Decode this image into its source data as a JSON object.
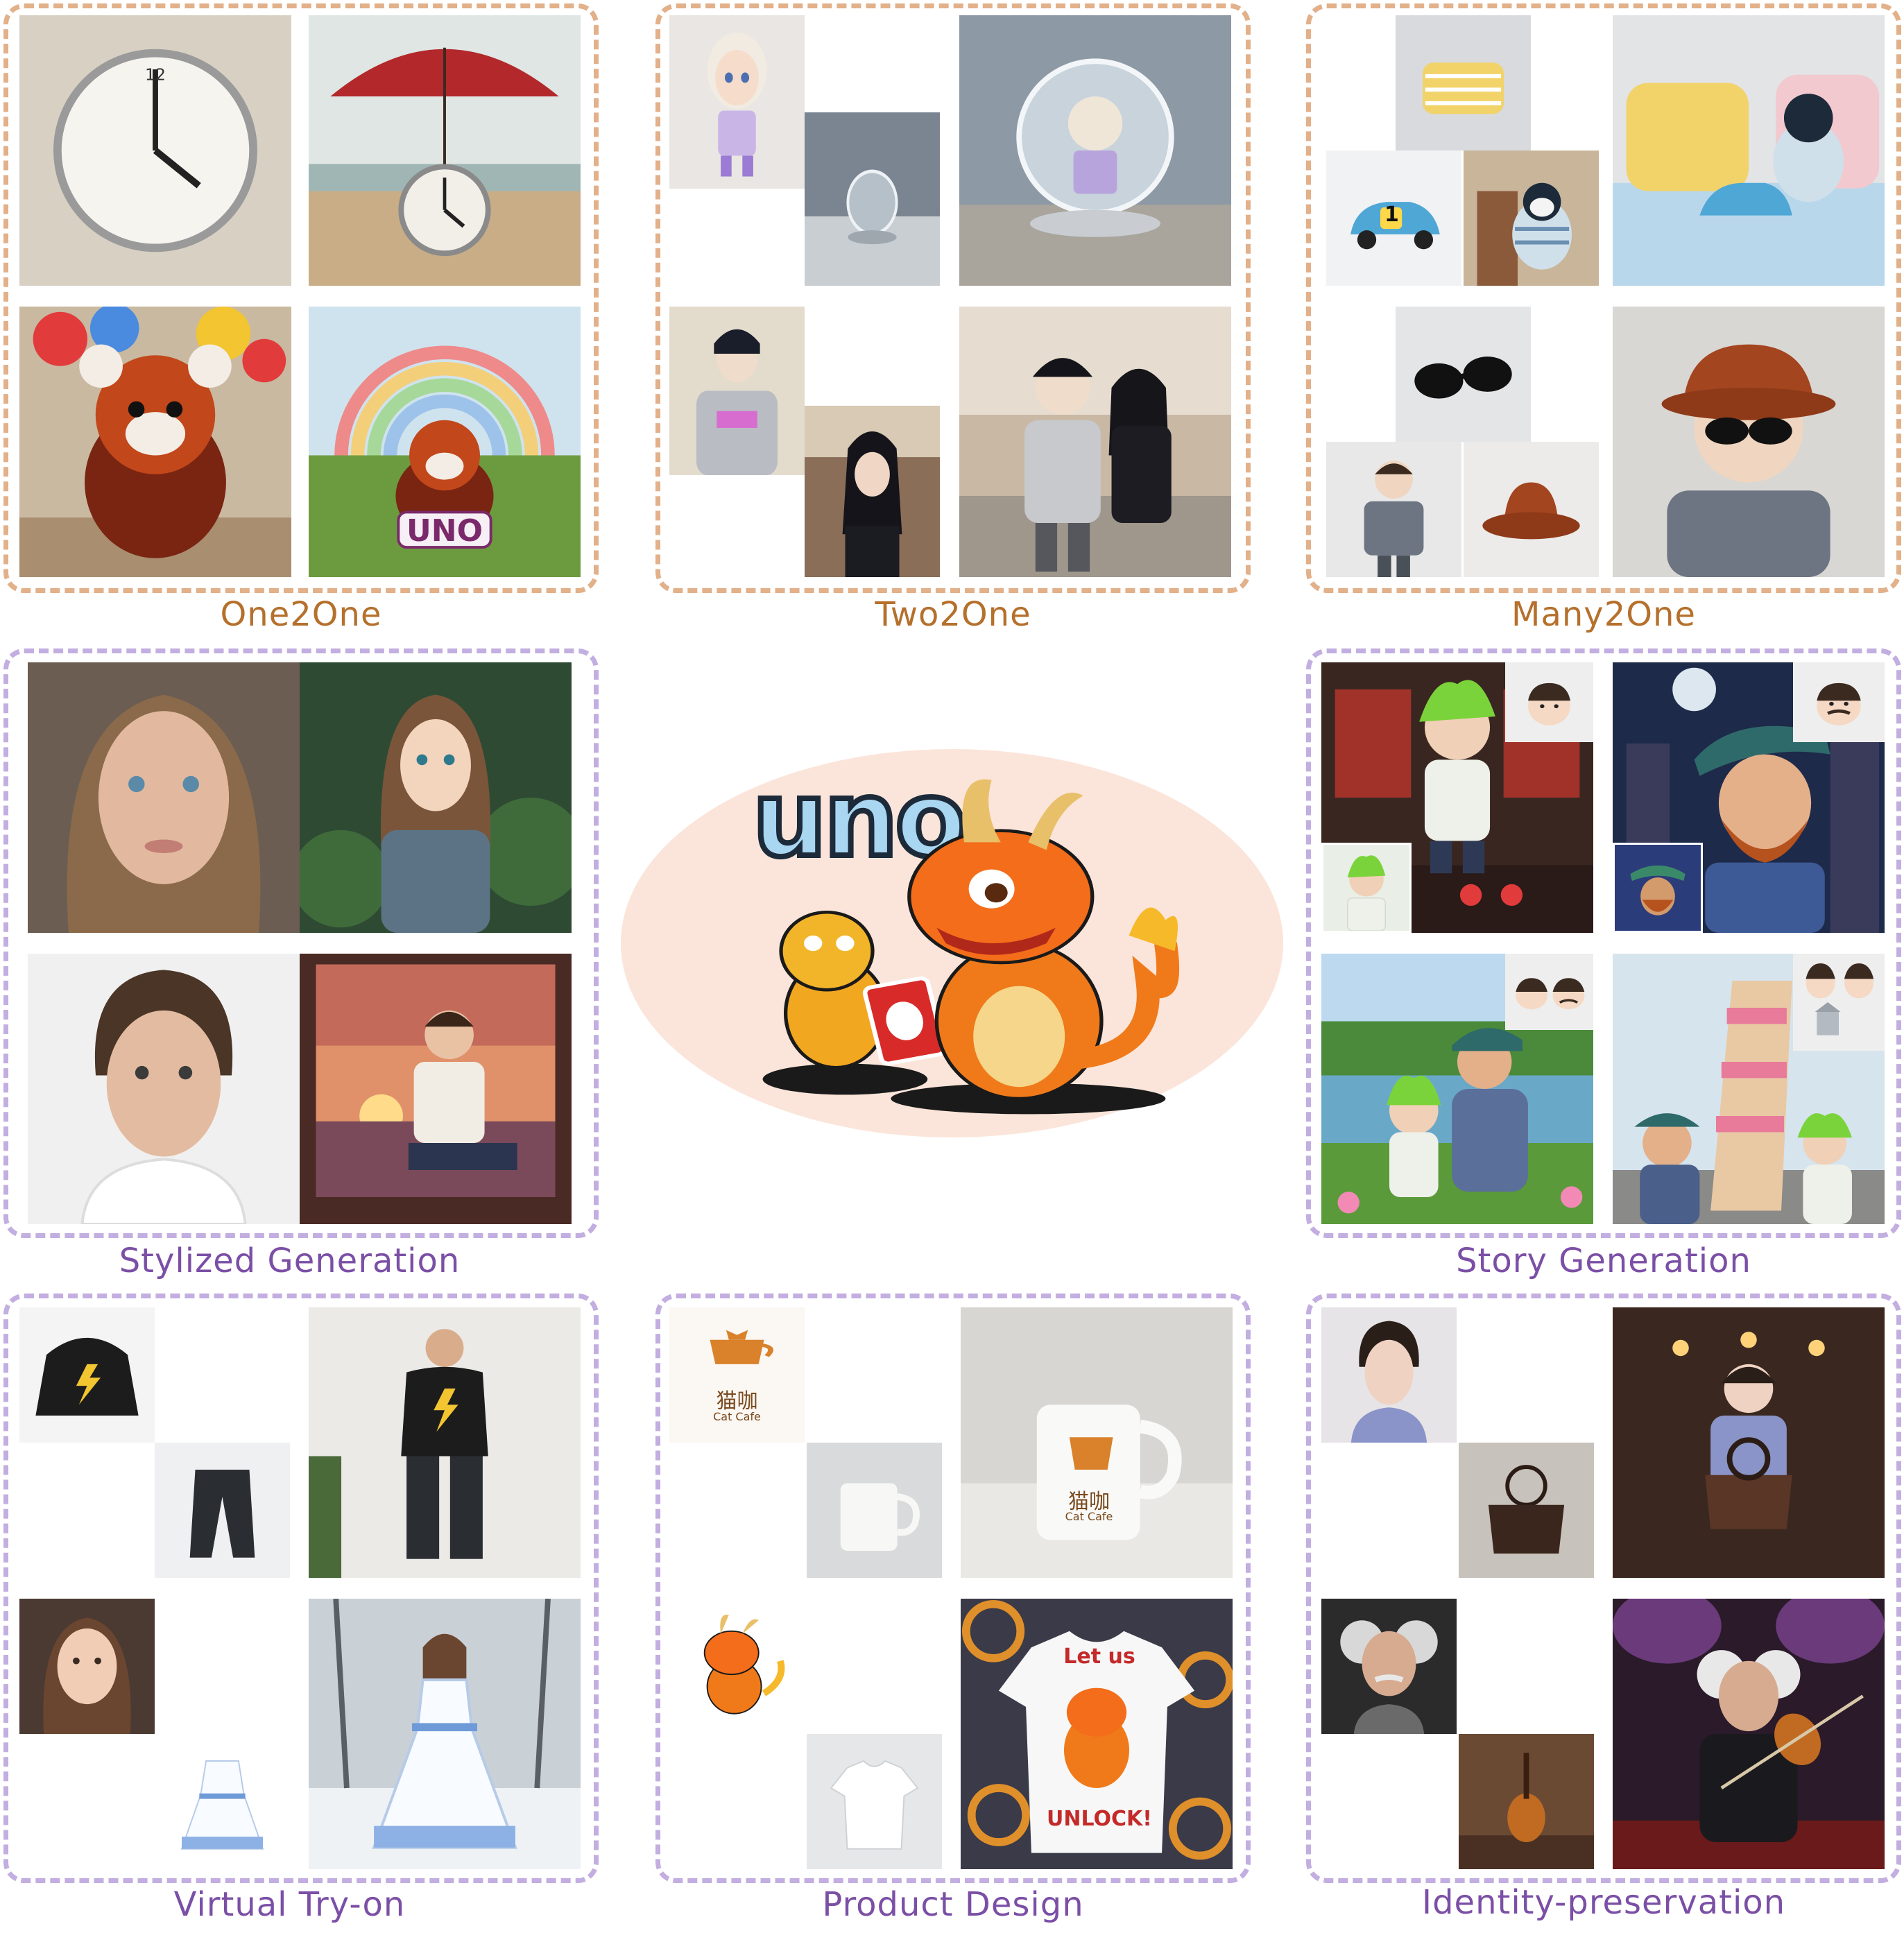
{
  "sections": {
    "one2one": "One2One",
    "two2one": "Two2One",
    "many2one": "Many2One",
    "stylized": "Stylized Generation",
    "story": "Story Generation",
    "tryon": "Virtual Try-on",
    "product": "Product Design",
    "identity": "Identity-preservation"
  },
  "logo": {
    "word": "uno"
  },
  "image_text": {
    "uno_sign": "UNO",
    "cat_cafe_cn": "猫咖",
    "cat_cafe_en": "Cat Cafe",
    "tshirt_top": "Let us",
    "tshirt_bottom": "UNLOCK!",
    "car_number": "1"
  },
  "colors": {
    "orange_border": "#e2b089",
    "purple_border": "#c2aee0",
    "orange_caption": "#b5702c",
    "purple_caption": "#7b4fa6",
    "oval_fill": "#fbe5da"
  }
}
